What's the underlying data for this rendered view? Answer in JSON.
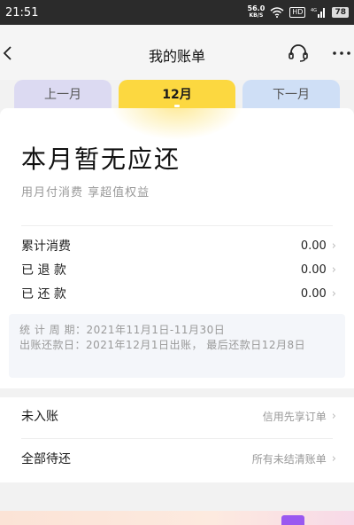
{
  "status_bar": {
    "time": "21:51",
    "net_speed_value": "56.0",
    "net_speed_unit": "KB/S",
    "hd_label": "HD",
    "network_label": "4G",
    "battery": "78"
  },
  "header": {
    "title": "我的账单"
  },
  "tabs": {
    "prev": "上一月",
    "current": "12月",
    "next": "下一月"
  },
  "summary": {
    "headline": "本月暂无应还",
    "subline": "用月付消费 享超值权益"
  },
  "rows": [
    {
      "label": "累计消费",
      "value": "0.00"
    },
    {
      "label": "已 退 款",
      "value": "0.00"
    },
    {
      "label": "已 还 款",
      "value": "0.00"
    }
  ],
  "info": {
    "period_key": "统 计 周 期：",
    "period_value": "2021年11月1日-11月30日",
    "billing_key": "出账还款日：",
    "billing_value": "2021年12月1日出账， 最后还款日12月8日"
  },
  "lower": {
    "pending_label": "未入账",
    "pending_link": "信用先享订单",
    "all_label": "全部待还",
    "all_link": "所有未结清账单"
  },
  "colors": {
    "accent_yellow": "#fcd840",
    "prev_tab": "#dcdaf2",
    "next_tab": "#cfdff6"
  }
}
